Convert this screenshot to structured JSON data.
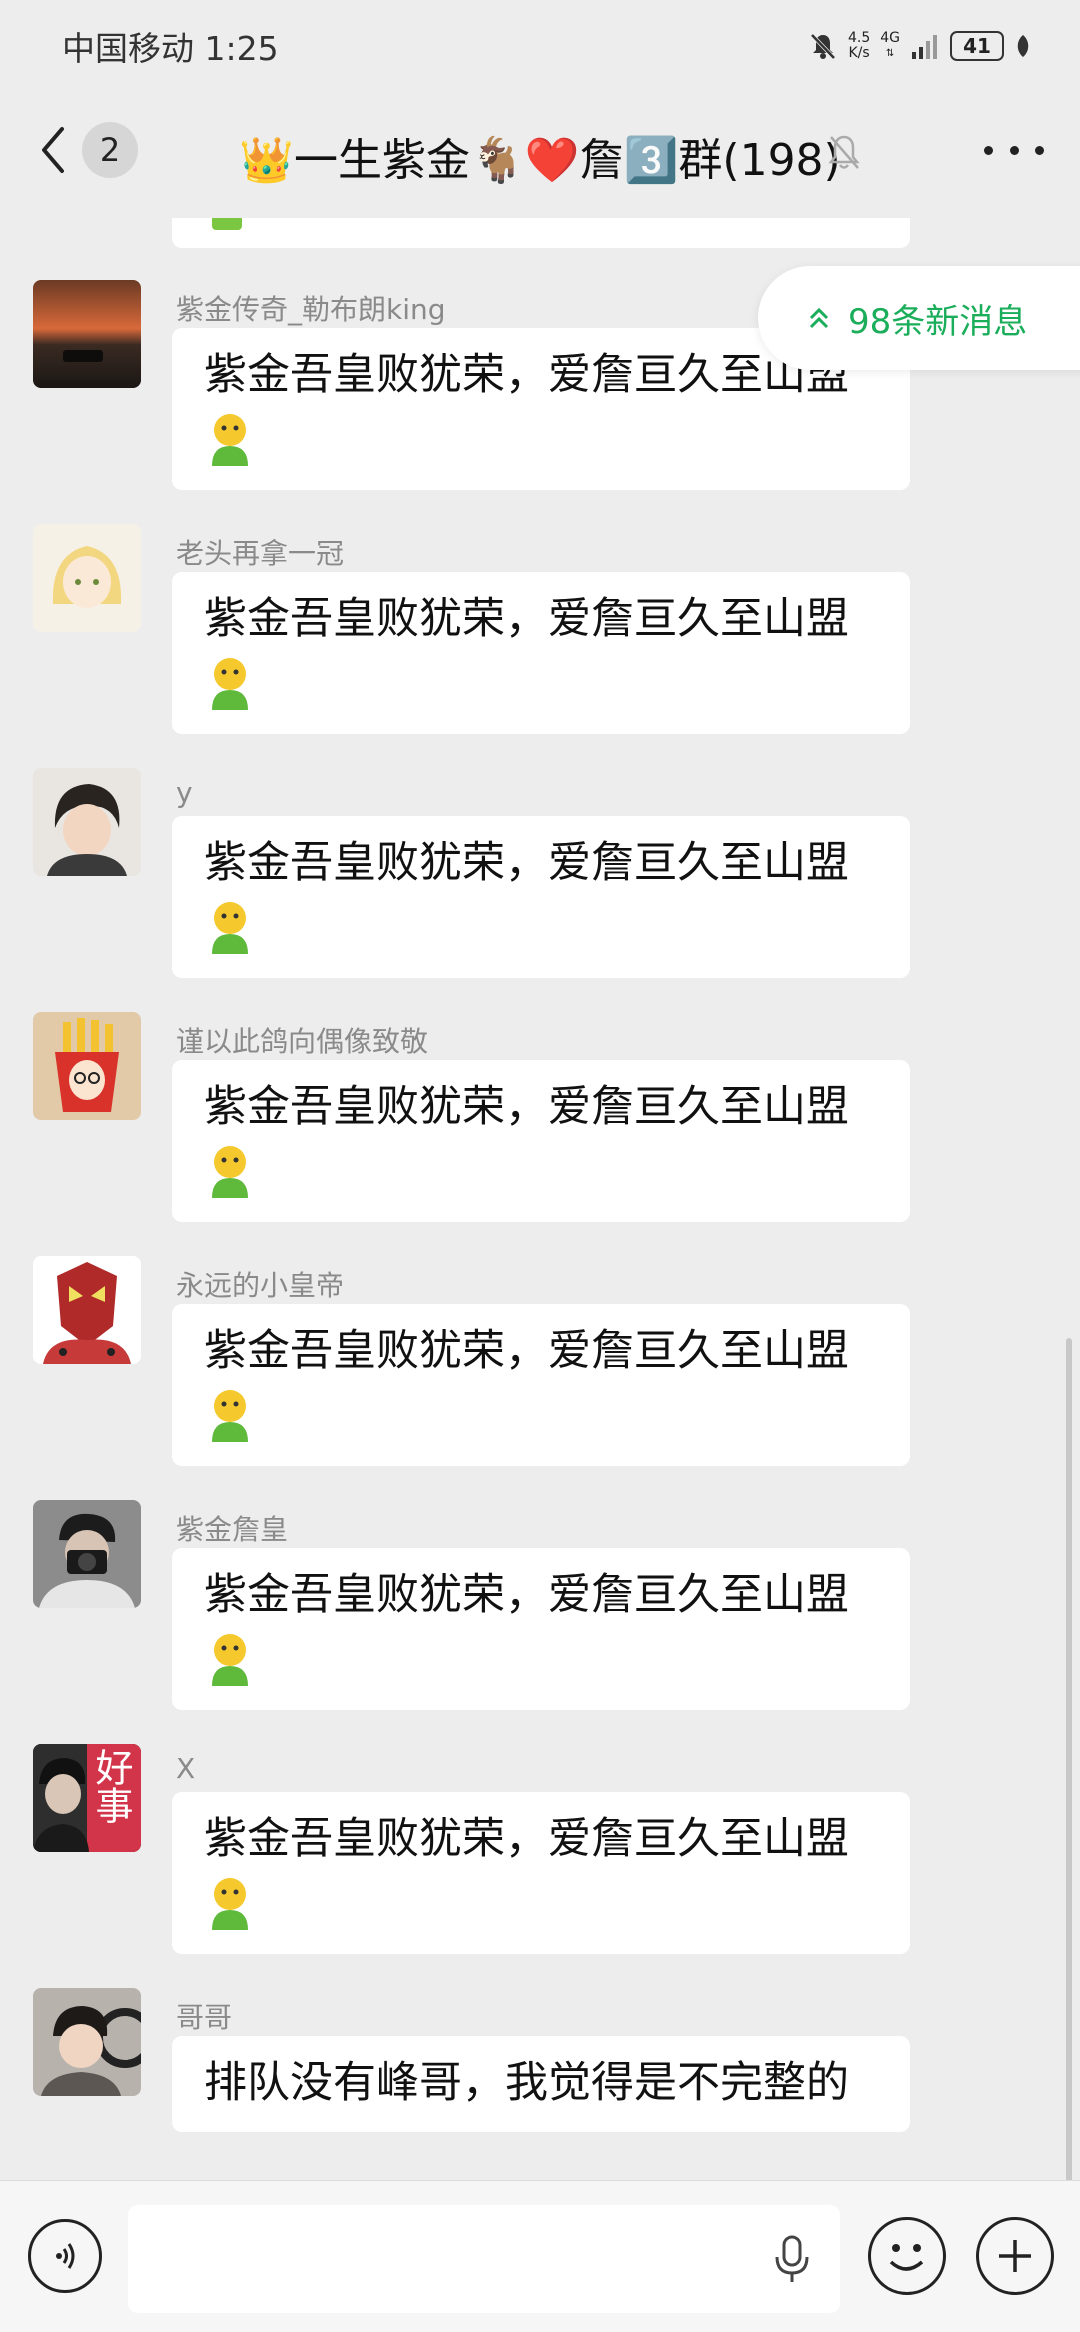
{
  "status_bar": {
    "carrier_time": "中国移动 1:25",
    "net_speed_value": "4.5",
    "net_speed_unit": "K/s",
    "network_type": "4G",
    "battery": "41"
  },
  "header": {
    "unread_count": "2",
    "title": "👑一生紫金🐐❤️詹3️⃣群(198)"
  },
  "new_messages": {
    "label": "98条新消息"
  },
  "messages": [
    {
      "sender": "紫金传奇_勒布朗king",
      "text": "紫金吾皇败犹荣，爱詹亘久至山盟",
      "emoji": "green-person-emoji"
    },
    {
      "sender": "老头再拿一冠",
      "text": "紫金吾皇败犹荣，爱詹亘久至山盟",
      "emoji": "green-person-emoji"
    },
    {
      "sender": "y",
      "text": "紫金吾皇败犹荣，爱詹亘久至山盟",
      "emoji": "green-person-emoji"
    },
    {
      "sender": "谨以此鸽向偶像致敬",
      "text": "紫金吾皇败犹荣，爱詹亘久至山盟",
      "emoji": "green-person-emoji"
    },
    {
      "sender": "永远的小皇帝",
      "text": "紫金吾皇败犹荣，爱詹亘久至山盟",
      "emoji": "green-person-emoji"
    },
    {
      "sender": "紫金詹皇",
      "text": "紫金吾皇败犹荣，爱詹亘久至山盟",
      "emoji": "green-person-emoji"
    },
    {
      "sender": "X",
      "text": "紫金吾皇败犹荣，爱詹亘久至山盟",
      "emoji": "green-person-emoji"
    },
    {
      "sender": "哥哥",
      "text": "排队没有峰哥，我觉得是不完整的"
    }
  ],
  "avatar_text": {
    "x_avatar": "好事"
  },
  "input": {
    "value": "",
    "placeholder": ""
  },
  "colors": {
    "accent_green": "#1aad5a",
    "background": "#ededed"
  }
}
